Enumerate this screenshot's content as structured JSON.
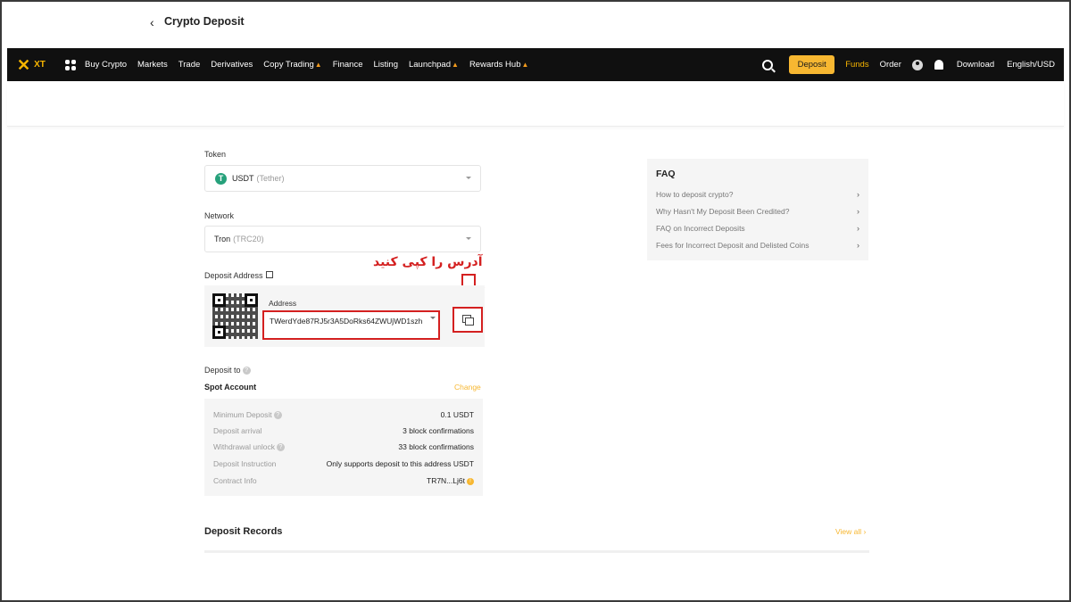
{
  "nav": {
    "logo": "XT",
    "items": [
      {
        "label": "Buy Crypto",
        "hot": false
      },
      {
        "label": "Markets",
        "hot": false
      },
      {
        "label": "Trade",
        "hot": false
      },
      {
        "label": "Derivatives",
        "hot": false
      },
      {
        "label": "Copy Trading",
        "hot": true
      },
      {
        "label": "Finance",
        "hot": false
      },
      {
        "label": "Listing",
        "hot": false
      },
      {
        "label": "Launchpad",
        "hot": true
      },
      {
        "label": "Rewards Hub",
        "hot": true
      }
    ],
    "deposit_button": "Deposit",
    "funds": "Funds",
    "order": "Order",
    "download": "Download",
    "language": "English/USD"
  },
  "header": {
    "title": "Crypto Deposit"
  },
  "form": {
    "token_label": "Token",
    "token_value": "USDT",
    "token_name": "(Tether)",
    "network_label": "Network",
    "network_value": "Tron",
    "network_code": "(TRC20)",
    "deposit_address_label": "Deposit Address",
    "address_label": "Address",
    "address_value": "TWerdYde87RJ5r3A5DoRks64ZWUjWD1szh",
    "annotation": "آدرس را کپی کنید",
    "deposit_to_label": "Deposit to",
    "account": "Spot Account",
    "change": "Change"
  },
  "info": [
    {
      "key": "Minimum Deposit",
      "value": "0.1 USDT",
      "help": true
    },
    {
      "key": "Deposit arrival",
      "value": "3 block confirmations",
      "help": false
    },
    {
      "key": "Withdrawal unlock",
      "value": "33 block confirmations",
      "help": true
    },
    {
      "key": "Deposit Instruction",
      "value": "Only supports deposit to this address USDT",
      "help": false
    },
    {
      "key": "Contract Info",
      "value": "TR7N...Lj6t",
      "help": false
    }
  ],
  "records": {
    "title": "Deposit Records",
    "view_all": "View all"
  },
  "faq": {
    "title": "FAQ",
    "items": [
      "How to deposit crypto?",
      "Why Hasn't My Deposit Been Credited?",
      "FAQ on Incorrect Deposits",
      "Fees for Incorrect Deposit and Delisted Coins"
    ]
  },
  "colors": {
    "accent": "#f7b731",
    "highlight": "#d42020",
    "nav_bg": "#101010"
  }
}
